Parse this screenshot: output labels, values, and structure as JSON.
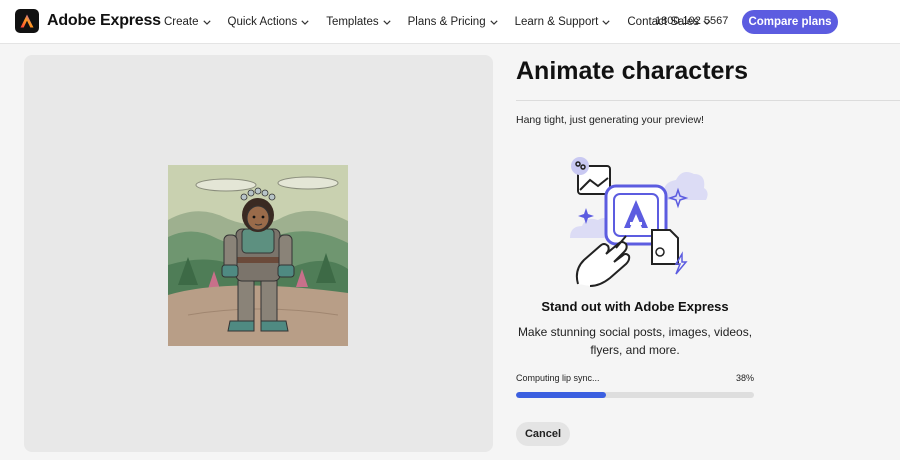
{
  "header": {
    "brand": "Adobe Express",
    "nav": [
      "Create",
      "Quick Actions",
      "Templates",
      "Plans & Pricing",
      "Learn & Support",
      "Contact Sales"
    ],
    "phone": "1800 102 5567",
    "cta_label": "Compare plans"
  },
  "main": {
    "title": "Animate characters",
    "status_message": "Hang tight, just generating your preview!",
    "promo_title": "Stand out with Adobe Express",
    "promo_text": "Make stunning social posts, images, videos, flyers, and more.",
    "progress": {
      "label": "Computing lip sync...",
      "percent_label": "38%",
      "value": 0.38
    },
    "cancel_label": "Cancel"
  },
  "colors": {
    "accent": "#5c5ce0",
    "progress": "#3b5fe0",
    "panel": "#e8e8e8"
  },
  "icons": [
    "adobe-express-logo",
    "chevron-down-icon",
    "express-illustration"
  ]
}
